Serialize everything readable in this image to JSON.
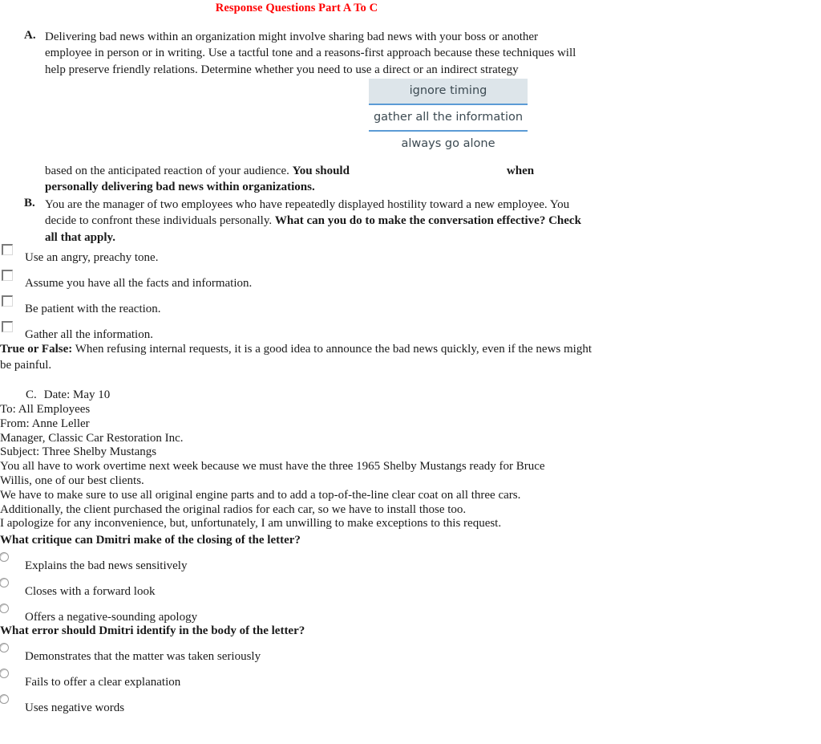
{
  "title": "Response Questions Part A To C",
  "title_color": "#ff0000",
  "part_a": {
    "marker": "A.",
    "text": "Delivering bad news within an organization might involve sharing bad news with your boss or another employee in person or in writing. Use a tactful tone and a reasons-first approach because these techniques will help preserve friendly relations. Determine whether you need to use a direct or an indirect strategy",
    "dropdown": {
      "name": "strategy-select",
      "selected": "ignore timing",
      "options": [
        "ignore timing",
        "gather all the information",
        "always go alone"
      ],
      "highlight_color": "#dde5ea",
      "divider_color": "#5b9bd5"
    },
    "continue_plain": "based on the anticipated reaction of your audience. ",
    "continue_bold_1": "You should",
    "continue_after_gap": "when",
    "continue_bold_2": "personally delivering bad news within organizations."
  },
  "part_b": {
    "marker": "B.",
    "text_plain_1": "You are the manager of two employees who have repeatedly displayed hostility toward a new employee. You decide to confront these individuals personally. ",
    "text_bold": "What can you do to make the conversation effective? Check all that apply.",
    "checkboxes": [
      "Use an angry, preachy tone.",
      "Assume you have all the facts and information.",
      "Be patient with the reaction.",
      "Gather all the information."
    ]
  },
  "true_false": {
    "label": "True or False:",
    "statement": " When refusing internal requests, it is a good idea to announce the bad news quickly, even if the news might be painful."
  },
  "part_c": {
    "marker": "C.",
    "date_line": "Date: May 10",
    "memo_lines": [
      "To: All Employees",
      "From: Anne Leller",
      "Manager, Classic Car Restoration Inc.",
      "Subject: Three Shelby Mustangs",
      "You all have to work overtime next week because we must have the three 1965 Shelby Mustangs ready for Bruce Willis, one of our best clients.",
      "We have to make sure to use all original engine parts and to add a top-of-the-line clear coat on all three cars.",
      "Additionally, the client purchased the original radios for each car, so we have to install those too.",
      "I apologize for any inconvenience, but, unfortunately, I am unwilling to make exceptions to this request."
    ],
    "question_closing": "What critique can Dmitri make of the closing of the letter?",
    "closing_options": [
      "Explains the bad news sensitively",
      "Closes with a forward look",
      "Offers a negative-sounding apology"
    ],
    "question_body": "What error should Dmitri identify in the body of the letter?",
    "body_options": [
      "Demonstrates that the matter was taken seriously",
      "Fails to offer a clear explanation",
      "Uses negative words"
    ]
  }
}
